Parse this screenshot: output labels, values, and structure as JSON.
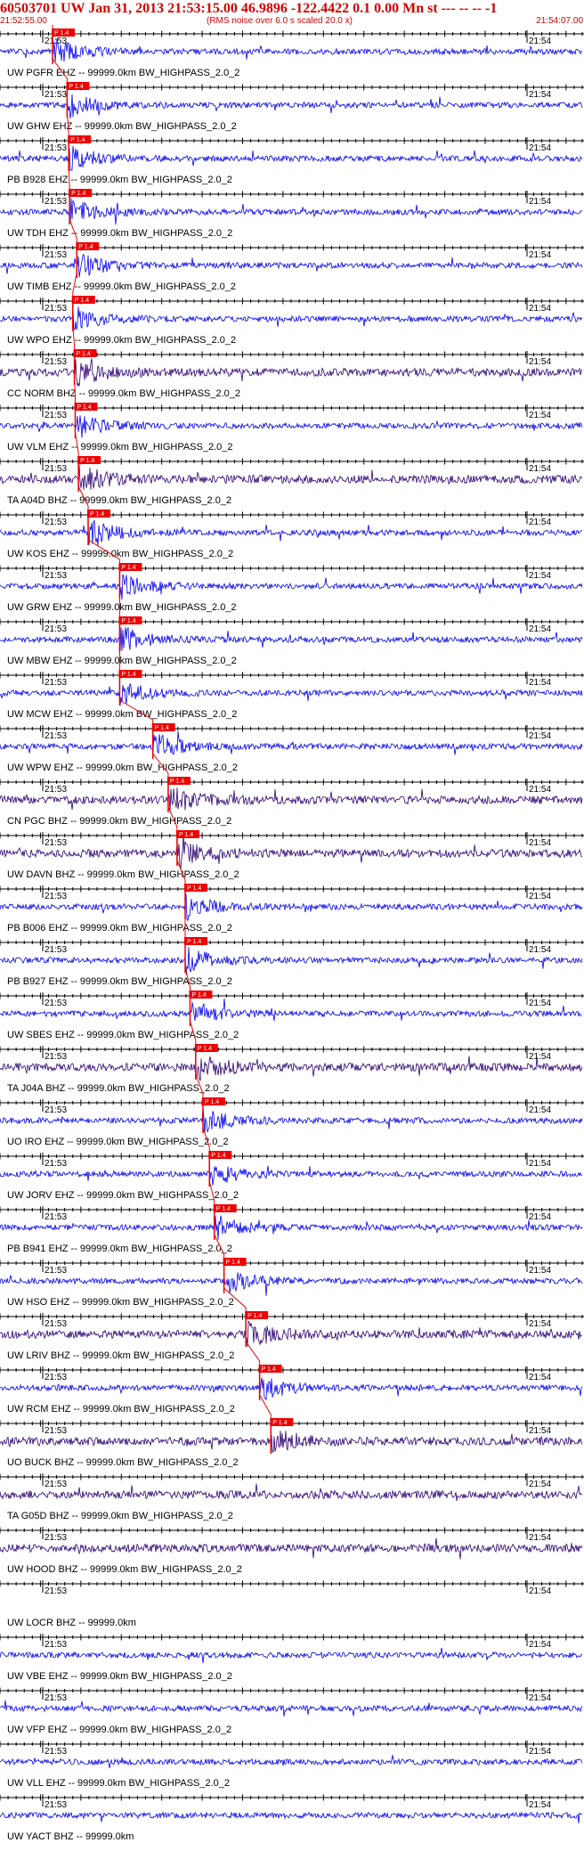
{
  "header": {
    "title": "60503701 UW Jan 31, 2013 21:53:15.00   46.9896 -122.4422  0.1 0.00 Mn st --- -- --   -1",
    "start_time": "21:52:55.00",
    "note": "(RMS noise over 6.0 s scaled 20.0 x)",
    "end_time": "21:54:07.00"
  },
  "colors": {
    "title": "#d40000",
    "trace_blue": "#0000ee",
    "trace_dark": "#2a0070",
    "pick": "#ee0000",
    "axis": "#000000"
  },
  "chart_data": {
    "type": "seismogram",
    "x_range_seconds": [
      0,
      72
    ],
    "tick_label_left": "21:53",
    "tick_label_right": "21:54",
    "pick_label": "P 1.4",
    "traces": [
      {
        "label": "UW PGFR EHZ -- 99999.0km BW_HIGHPASS_2.0_2",
        "pick_s": 6.5,
        "style": "blue"
      },
      {
        "label": "UW GHW EHZ -- 99999.0km BW_HIGHPASS_2.0_2",
        "pick_s": 8.3,
        "style": "blue"
      },
      {
        "label": "PB B928 EHZ -- 99999.0km BW_HIGHPASS_2.0_2",
        "pick_s": 8.5,
        "style": "blue"
      },
      {
        "label": "UW TDH EHZ -- 99999.0km BW_HIGHPASS_2.0_2",
        "pick_s": 8.6,
        "style": "blue"
      },
      {
        "label": "UW TIMB EHZ -- 99999.0km BW_HIGHPASS_2.0_2",
        "pick_s": 9.5,
        "style": "blue"
      },
      {
        "label": "UW WPO EHZ -- 99999.0km BW_HIGHPASS_2.0_2",
        "pick_s": 9.0,
        "style": "blue"
      },
      {
        "label": "CC NORM BHZ -- 99999.0km BW_HIGHPASS_2.0_2",
        "pick_s": 9.2,
        "style": "dark"
      },
      {
        "label": "UW VLM EHZ -- 99999.0km BW_HIGHPASS_2.0_2",
        "pick_s": 9.3,
        "style": "blue"
      },
      {
        "label": "TA A04D BHZ -- 99999.0km BW_HIGHPASS_2.0_2",
        "pick_s": 9.7,
        "style": "dark"
      },
      {
        "label": "UW KOS EHZ -- 99999.0km BW_HIGHPASS_2.0_2",
        "pick_s": 10.9,
        "style": "blue"
      },
      {
        "label": "UW GRW EHZ -- 99999.0km BW_HIGHPASS_2.0_2",
        "pick_s": 14.8,
        "style": "blue"
      },
      {
        "label": "UW MBW EHZ -- 99999.0km BW_HIGHPASS_2.0_2",
        "pick_s": 14.8,
        "style": "blue"
      },
      {
        "label": "UW MCW EHZ -- 99999.0km BW_HIGHPASS_2.0_2",
        "pick_s": 14.8,
        "style": "blue"
      },
      {
        "label": "UW WPW EHZ -- 99999.0km BW_HIGHPASS_2.0_2",
        "pick_s": 18.9,
        "style": "blue"
      },
      {
        "label": "CN PGC BHZ -- 99999.0km BW_HIGHPASS_2.0_2",
        "pick_s": 20.8,
        "style": "dark"
      },
      {
        "label": "UW DAVN BHZ -- 99999.0km BW_HIGHPASS_2.0_2",
        "pick_s": 21.9,
        "style": "dark"
      },
      {
        "label": "PB B006 EHZ -- 99999.0km BW_HIGHPASS_2.0_2",
        "pick_s": 22.9,
        "style": "blue"
      },
      {
        "label": "PB B927 EHZ -- 99999.0km BW_HIGHPASS_2.0_2",
        "pick_s": 22.9,
        "style": "blue"
      },
      {
        "label": "UW SBES EHZ -- 99999.0km BW_HIGHPASS_2.0_2",
        "pick_s": 23.5,
        "style": "blue"
      },
      {
        "label": "TA J04A BHZ -- 99999.0km BW_HIGHPASS_2.0_2",
        "pick_s": 24.2,
        "style": "dark"
      },
      {
        "label": "UO IRO EHZ -- 99999.0km BW_HIGHPASS_2.0_2",
        "pick_s": 25.1,
        "style": "blue"
      },
      {
        "label": "UW JORV EHZ -- 99999.0km BW_HIGHPASS_2.0_2",
        "pick_s": 25.9,
        "style": "blue"
      },
      {
        "label": "PB B941 EHZ -- 99999.0km BW_HIGHPASS_2.0_2",
        "pick_s": 26.5,
        "style": "blue"
      },
      {
        "label": "UW HSO EHZ -- 99999.0km BW_HIGHPASS_2.0_2",
        "pick_s": 27.7,
        "style": "blue"
      },
      {
        "label": "UW LRIV BHZ -- 99999.0km BW_HIGHPASS_2.0_2",
        "pick_s": 30.4,
        "style": "dark"
      },
      {
        "label": "UW RCM EHZ -- 99999.0km BW_HIGHPASS_2.0_2",
        "pick_s": 32.1,
        "style": "blue"
      },
      {
        "label": "UO BUCK BHZ -- 99999.0km BW_HIGHPASS_2.0_2",
        "pick_s": 33.5,
        "style": "dark"
      },
      {
        "label": "TA G05D BHZ -- 99999.0km BW_HIGHPASS_2.0_2",
        "pick_s": null,
        "style": "dark"
      },
      {
        "label": "UW HOOD BHZ -- 99999.0km BW_HIGHPASS_2.0_2",
        "pick_s": null,
        "style": "dark"
      },
      {
        "label": "UW LOCR BHZ -- 99999.0km",
        "pick_s": null,
        "style": "none"
      },
      {
        "label": "UW VBE EHZ -- 99999.0km BW_HIGHPASS_2.0_2",
        "pick_s": null,
        "style": "blue"
      },
      {
        "label": "UW VFP EHZ -- 99999.0km BW_HIGHPASS_2.0_2",
        "pick_s": null,
        "style": "blue"
      },
      {
        "label": "UW VLL EHZ -- 99999.0km BW_HIGHPASS_2.0_2",
        "pick_s": null,
        "style": "blue"
      },
      {
        "label": "UW YACT BHZ -- 99999.0km",
        "pick_s": null,
        "style": "blue"
      }
    ]
  }
}
